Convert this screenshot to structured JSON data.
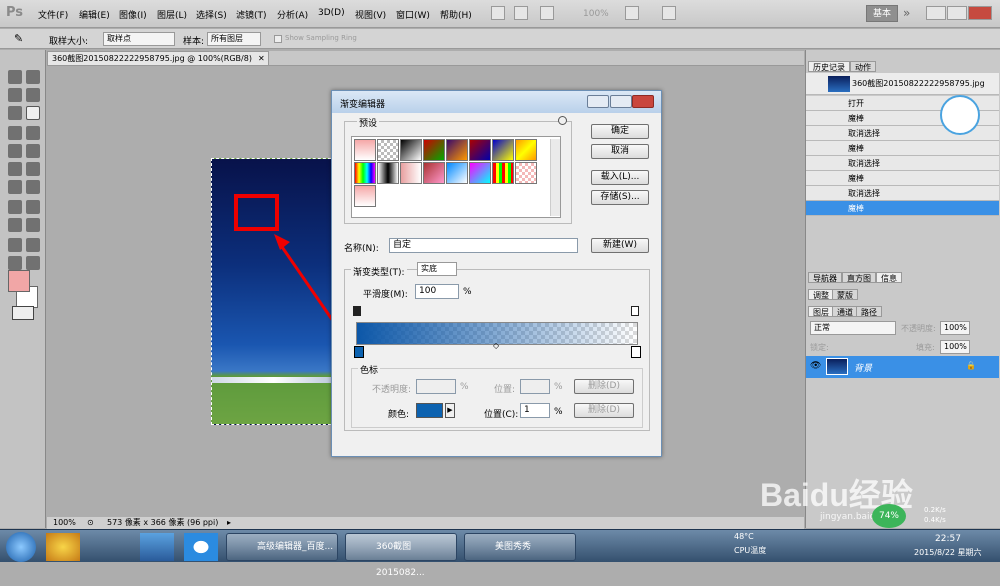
{
  "menubar": {
    "logo": "Ps",
    "items": [
      "文件(F)",
      "编辑(E)",
      "图像(I)",
      "图层(L)",
      "选择(S)",
      "滤镜(T)",
      "分析(A)",
      "3D(D)",
      "视图(V)",
      "窗口(W)",
      "帮助(H)"
    ],
    "zoom": "100%",
    "workspace": "基本"
  },
  "options": {
    "sample_size_label": "取样大小:",
    "sample_size_value": "取样点",
    "sample_label": "样本:",
    "sample_value": "所有图层",
    "ring_label": "Show Sampling Ring"
  },
  "document": {
    "tab_title": "360截图20150822222958795.jpg @ 100%(RGB/8)",
    "zoom": "100%",
    "info": "573 像素 x 366 像素 (96 ppi)"
  },
  "dialog": {
    "title": "渐变编辑器",
    "presets_label": "预设",
    "buttons": {
      "ok": "确定",
      "cancel": "取消",
      "load": "载入(L)...",
      "save": "存储(S)...",
      "new": "新建(W)",
      "delete1": "删除(D)",
      "delete2": "删除(D)"
    },
    "name_label": "名称(N):",
    "name_value": "自定",
    "gradient_type_label": "渐变类型(T):",
    "gradient_type_value": "实底",
    "smoothness_label": "平滑度(M):",
    "smoothness_value": "100",
    "smoothness_unit": "%",
    "stops_label": "色标",
    "opacity_label": "不透明度:",
    "opacity_unit": "%",
    "location_label1": "位置:",
    "location_unit1": "%",
    "color_label": "颜色:",
    "location_label2": "位置(C):",
    "location_value": "1",
    "location_unit2": "%",
    "stop_color": "#0c62b0"
  },
  "history": {
    "tabs": [
      "历史记录",
      "动作"
    ],
    "snapshot": "360截图20150822222958795.jpg",
    "items": [
      "打开",
      "魔棒",
      "取消选择",
      "魔棒",
      "取消选择",
      "魔棒",
      "取消选择",
      "魔棒"
    ],
    "selected_index": 7
  },
  "panels": {
    "nav_tabs": [
      "导航器",
      "直方图",
      "信息"
    ],
    "adjust_tabs": [
      "调整",
      "蒙版"
    ],
    "layer_tabs": [
      "图层",
      "通道",
      "路径"
    ],
    "blend_mode": "正常",
    "opacity_label": "不透明度:",
    "opacity_value": "100%",
    "lock_label": "锁定:",
    "fill_label": "填充:",
    "fill_value": "100%",
    "layer_name": "背景"
  },
  "overlay": {
    "watermark": "Baidu经验",
    "url": "jingyan.baidu.com",
    "cpu_percent": "74%",
    "net_up": "0.2K/s",
    "net_down": "0.4K/s"
  },
  "taskbar": {
    "items": [
      "高级编辑器_百度...",
      "360截图2015082...",
      "美图秀秀"
    ],
    "temp": "48°C",
    "temp_label": "CPU温度",
    "time": "22:57",
    "date": "2015/8/22 星期六"
  }
}
